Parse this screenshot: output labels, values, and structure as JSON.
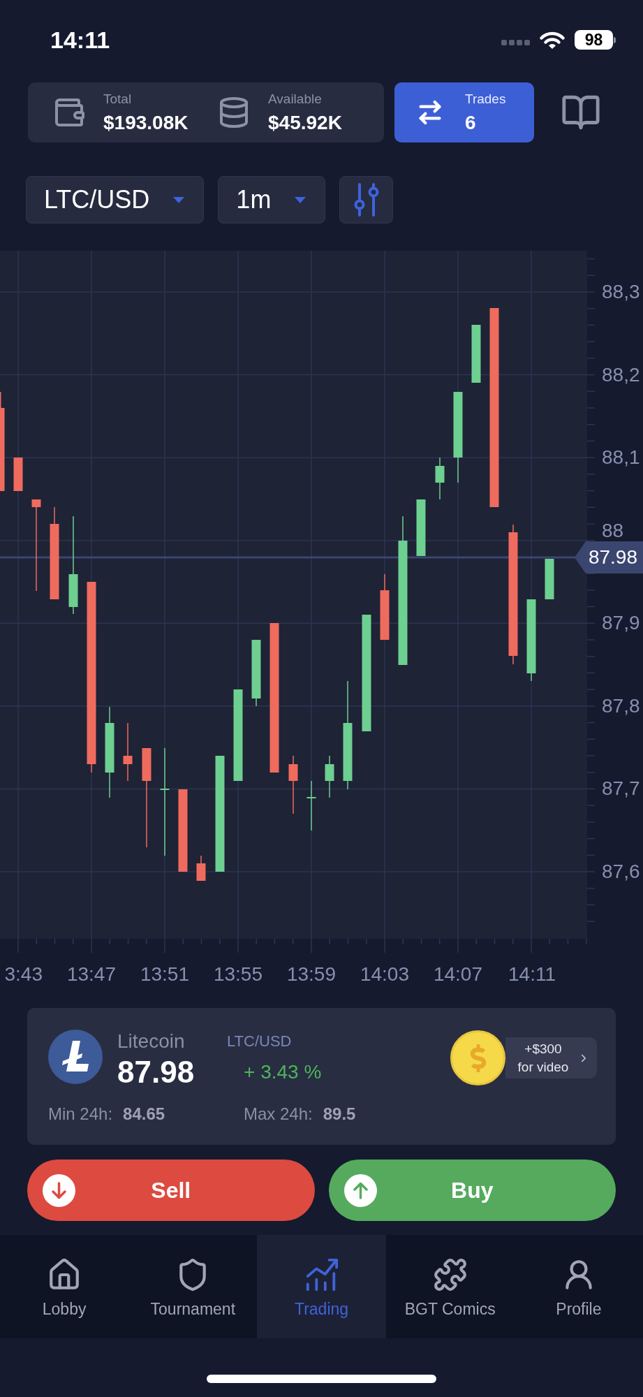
{
  "status_bar": {
    "time": "14:11",
    "battery": "98"
  },
  "balances": [
    {
      "kind": "wallet",
      "label": "Total",
      "value": "$193.08K"
    },
    {
      "kind": "coins",
      "label": "Available",
      "value": "$45.92K"
    }
  ],
  "trades": {
    "label": "Trades",
    "count": "6"
  },
  "selectors": [
    {
      "value": "LTC/USD"
    },
    {
      "value": "1m"
    }
  ],
  "chart": {
    "y_labels": [
      "88,3",
      "88,2",
      "88,1",
      "88",
      "87,9",
      "87,8",
      "87,7",
      "87,6"
    ],
    "x_labels": [
      "3:43",
      "13:47",
      "13:51",
      "13:55",
      "13:59",
      "14:03",
      "14:07",
      "14:11"
    ],
    "price_tag": "87.98"
  },
  "asset": {
    "name": "Litecoin",
    "price": "87.98",
    "pair": "LTC/USD",
    "change": "+ 3.43 %",
    "stats": [
      {
        "label": "Min 24h:",
        "value": "84.65"
      },
      {
        "label": "Max 24h:",
        "value": "89.5"
      }
    ],
    "bonus": {
      "amount": "+$300",
      "caption": "for video"
    }
  },
  "actions": [
    {
      "kind": "sell",
      "label": "Sell"
    },
    {
      "kind": "buy",
      "label": "Buy"
    }
  ],
  "tabs": [
    {
      "kind": "home",
      "label": "Lobby",
      "selected": false
    },
    {
      "kind": "shield",
      "label": "Tournament",
      "selected": false
    },
    {
      "kind": "chart",
      "label": "Trading",
      "selected": true
    },
    {
      "kind": "puzzle",
      "label": "BGT Comics",
      "selected": false
    },
    {
      "kind": "user",
      "label": "Profile",
      "selected": false
    }
  ]
}
